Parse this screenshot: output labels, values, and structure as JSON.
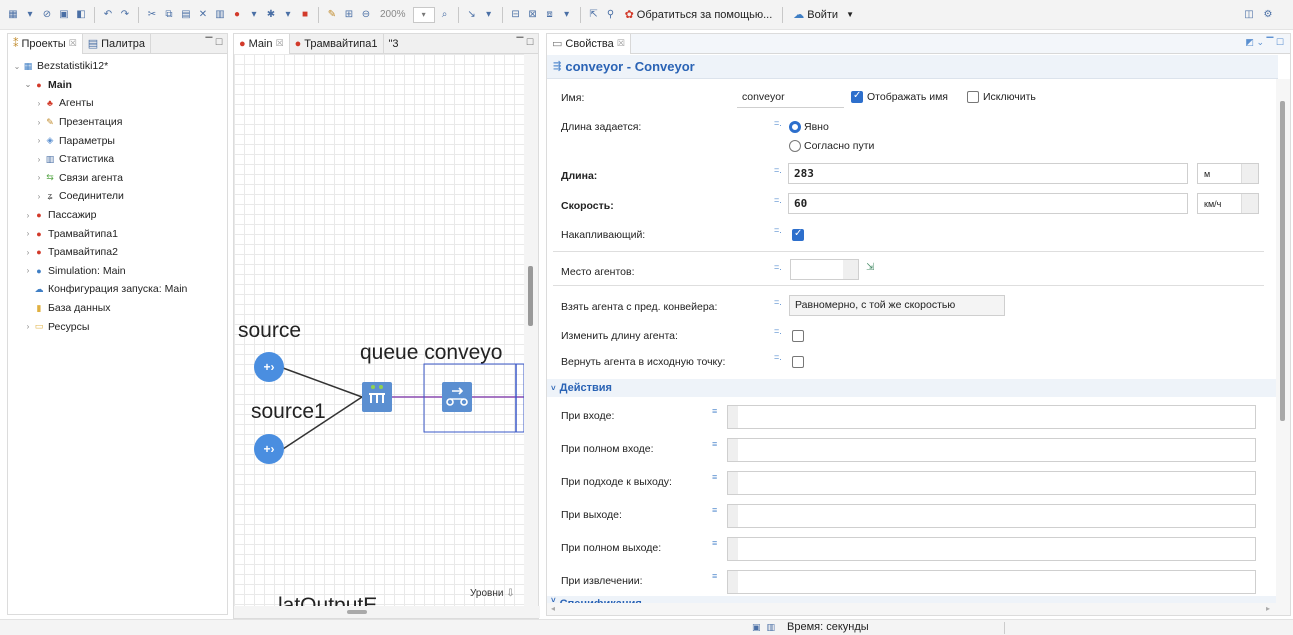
{
  "toolbar": {
    "zoom": "200%",
    "help_label": "Обратиться за помощью...",
    "login_label": "Войти"
  },
  "left_panel": {
    "tab_projects": "Проекты",
    "tab_palette": "Палитра",
    "tree": [
      {
        "label": "Bezstatistiki12*",
        "arrow": "⌄",
        "icon": "▦",
        "icon_color": "#3f7ec4",
        "indent": 0,
        "bold": false
      },
      {
        "label": "Main",
        "arrow": "⌄",
        "icon": "●",
        "icon_color": "#d23a2a",
        "indent": 1,
        "bold": true
      },
      {
        "label": "Агенты",
        "arrow": "›",
        "icon": "♣",
        "icon_color": "#d23a2a",
        "indent": 2,
        "bold": false
      },
      {
        "label": "Презентация",
        "arrow": "›",
        "icon": "✎",
        "icon_color": "#c08a2a",
        "indent": 2,
        "bold": false
      },
      {
        "label": "Параметры",
        "arrow": "›",
        "icon": "◈",
        "icon_color": "#5a8fd0",
        "indent": 2,
        "bold": false
      },
      {
        "label": "Статистика",
        "arrow": "›",
        "icon": "▥",
        "icon_color": "#4a6fa5",
        "indent": 2,
        "bold": false
      },
      {
        "label": "Связи агента",
        "arrow": "›",
        "icon": "⇆",
        "icon_color": "#5aa84a",
        "indent": 2,
        "bold": false
      },
      {
        "label": "Соединители",
        "arrow": "›",
        "icon": "ʑ",
        "icon_color": "#555555",
        "indent": 2,
        "bold": false
      },
      {
        "label": "Пассажир",
        "arrow": "›",
        "icon": "●",
        "icon_color": "#d23a2a",
        "indent": 1,
        "bold": false
      },
      {
        "label": "Трамвайтипа1",
        "arrow": "›",
        "icon": "●",
        "icon_color": "#d23a2a",
        "indent": 1,
        "bold": false
      },
      {
        "label": "Трамвайтипа2",
        "arrow": "›",
        "icon": "●",
        "icon_color": "#d23a2a",
        "indent": 1,
        "bold": false
      },
      {
        "label": "Simulation: Main",
        "arrow": "›",
        "icon": "●",
        "icon_color": "#3f7ec4",
        "indent": 1,
        "bold": false
      },
      {
        "label": "Конфигурация запуска: Main",
        "arrow": "",
        "icon": "☁",
        "icon_color": "#3f7ec4",
        "indent": 1,
        "bold": false
      },
      {
        "label": "База данных",
        "arrow": "",
        "icon": "▮",
        "icon_color": "#e0b040",
        "indent": 1,
        "bold": false
      },
      {
        "label": "Ресурсы",
        "arrow": "›",
        "icon": "▭",
        "icon_color": "#e0b040",
        "indent": 1,
        "bold": false
      }
    ]
  },
  "editor": {
    "tab_main": "Main",
    "tab_tram": "Трамвайтипа1",
    "tab_more": "\"3",
    "label_source": "source",
    "label_source1": "source1",
    "label_queue_conveyor": "queue conveyo",
    "label_bottom": "latOutputE",
    "label_levels": "Уровни"
  },
  "properties": {
    "tab": "Свойства",
    "title": "conveyor - Conveyor",
    "name_label": "Имя:",
    "name_value": "conveyor",
    "show_name_label": "Отображать имя",
    "show_name_checked": true,
    "exclude_label": "Исключить",
    "exclude_checked": false,
    "length_mode_label": "Длина задается:",
    "length_mode_explicit": "Явно",
    "length_mode_path": "Согласно пути",
    "length_label": "Длина:",
    "length_value": "283",
    "length_unit": "м",
    "speed_label": "Скорость:",
    "speed_value": "60",
    "speed_unit": "км/ч",
    "accumulating_label": "Накапливающий:",
    "accumulating_checked": true,
    "agent_place_label": "Место агентов:",
    "take_agent_label": "Взять агента с пред. конвейера:",
    "take_agent_value": "Равномерно, с той же скоростью",
    "change_length_label": "Изменить длину агента:",
    "return_agent_label": "Вернуть агента в исходную точку:",
    "actions_section": "Действия",
    "actions": [
      "При входе:",
      "При полном входе:",
      "При подходе к выходу:",
      "При выходе:",
      "При полном выходе:",
      "При извлечении:"
    ],
    "next_section": "Спецификация"
  },
  "status_bar": {
    "time_label": "Время: секунды"
  }
}
